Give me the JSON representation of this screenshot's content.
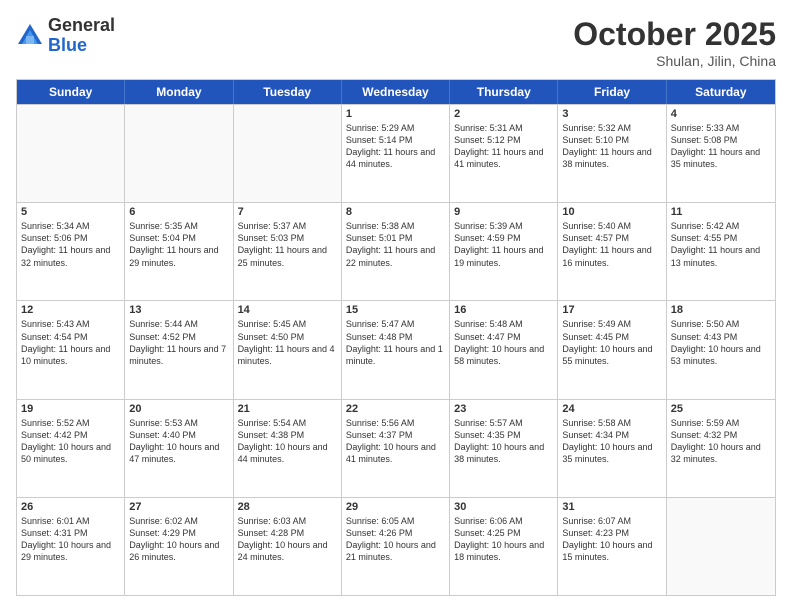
{
  "logo": {
    "general": "General",
    "blue": "Blue"
  },
  "title": "October 2025",
  "subtitle": "Shulan, Jilin, China",
  "days": [
    "Sunday",
    "Monday",
    "Tuesday",
    "Wednesday",
    "Thursday",
    "Friday",
    "Saturday"
  ],
  "weeks": [
    [
      {
        "day": "",
        "text": ""
      },
      {
        "day": "",
        "text": ""
      },
      {
        "day": "",
        "text": ""
      },
      {
        "day": "1",
        "text": "Sunrise: 5:29 AM\nSunset: 5:14 PM\nDaylight: 11 hours and 44 minutes."
      },
      {
        "day": "2",
        "text": "Sunrise: 5:31 AM\nSunset: 5:12 PM\nDaylight: 11 hours and 41 minutes."
      },
      {
        "day": "3",
        "text": "Sunrise: 5:32 AM\nSunset: 5:10 PM\nDaylight: 11 hours and 38 minutes."
      },
      {
        "day": "4",
        "text": "Sunrise: 5:33 AM\nSunset: 5:08 PM\nDaylight: 11 hours and 35 minutes."
      }
    ],
    [
      {
        "day": "5",
        "text": "Sunrise: 5:34 AM\nSunset: 5:06 PM\nDaylight: 11 hours and 32 minutes."
      },
      {
        "day": "6",
        "text": "Sunrise: 5:35 AM\nSunset: 5:04 PM\nDaylight: 11 hours and 29 minutes."
      },
      {
        "day": "7",
        "text": "Sunrise: 5:37 AM\nSunset: 5:03 PM\nDaylight: 11 hours and 25 minutes."
      },
      {
        "day": "8",
        "text": "Sunrise: 5:38 AM\nSunset: 5:01 PM\nDaylight: 11 hours and 22 minutes."
      },
      {
        "day": "9",
        "text": "Sunrise: 5:39 AM\nSunset: 4:59 PM\nDaylight: 11 hours and 19 minutes."
      },
      {
        "day": "10",
        "text": "Sunrise: 5:40 AM\nSunset: 4:57 PM\nDaylight: 11 hours and 16 minutes."
      },
      {
        "day": "11",
        "text": "Sunrise: 5:42 AM\nSunset: 4:55 PM\nDaylight: 11 hours and 13 minutes."
      }
    ],
    [
      {
        "day": "12",
        "text": "Sunrise: 5:43 AM\nSunset: 4:54 PM\nDaylight: 11 hours and 10 minutes."
      },
      {
        "day": "13",
        "text": "Sunrise: 5:44 AM\nSunset: 4:52 PM\nDaylight: 11 hours and 7 minutes."
      },
      {
        "day": "14",
        "text": "Sunrise: 5:45 AM\nSunset: 4:50 PM\nDaylight: 11 hours and 4 minutes."
      },
      {
        "day": "15",
        "text": "Sunrise: 5:47 AM\nSunset: 4:48 PM\nDaylight: 11 hours and 1 minute."
      },
      {
        "day": "16",
        "text": "Sunrise: 5:48 AM\nSunset: 4:47 PM\nDaylight: 10 hours and 58 minutes."
      },
      {
        "day": "17",
        "text": "Sunrise: 5:49 AM\nSunset: 4:45 PM\nDaylight: 10 hours and 55 minutes."
      },
      {
        "day": "18",
        "text": "Sunrise: 5:50 AM\nSunset: 4:43 PM\nDaylight: 10 hours and 53 minutes."
      }
    ],
    [
      {
        "day": "19",
        "text": "Sunrise: 5:52 AM\nSunset: 4:42 PM\nDaylight: 10 hours and 50 minutes."
      },
      {
        "day": "20",
        "text": "Sunrise: 5:53 AM\nSunset: 4:40 PM\nDaylight: 10 hours and 47 minutes."
      },
      {
        "day": "21",
        "text": "Sunrise: 5:54 AM\nSunset: 4:38 PM\nDaylight: 10 hours and 44 minutes."
      },
      {
        "day": "22",
        "text": "Sunrise: 5:56 AM\nSunset: 4:37 PM\nDaylight: 10 hours and 41 minutes."
      },
      {
        "day": "23",
        "text": "Sunrise: 5:57 AM\nSunset: 4:35 PM\nDaylight: 10 hours and 38 minutes."
      },
      {
        "day": "24",
        "text": "Sunrise: 5:58 AM\nSunset: 4:34 PM\nDaylight: 10 hours and 35 minutes."
      },
      {
        "day": "25",
        "text": "Sunrise: 5:59 AM\nSunset: 4:32 PM\nDaylight: 10 hours and 32 minutes."
      }
    ],
    [
      {
        "day": "26",
        "text": "Sunrise: 6:01 AM\nSunset: 4:31 PM\nDaylight: 10 hours and 29 minutes."
      },
      {
        "day": "27",
        "text": "Sunrise: 6:02 AM\nSunset: 4:29 PM\nDaylight: 10 hours and 26 minutes."
      },
      {
        "day": "28",
        "text": "Sunrise: 6:03 AM\nSunset: 4:28 PM\nDaylight: 10 hours and 24 minutes."
      },
      {
        "day": "29",
        "text": "Sunrise: 6:05 AM\nSunset: 4:26 PM\nDaylight: 10 hours and 21 minutes."
      },
      {
        "day": "30",
        "text": "Sunrise: 6:06 AM\nSunset: 4:25 PM\nDaylight: 10 hours and 18 minutes."
      },
      {
        "day": "31",
        "text": "Sunrise: 6:07 AM\nSunset: 4:23 PM\nDaylight: 10 hours and 15 minutes."
      },
      {
        "day": "",
        "text": ""
      }
    ]
  ]
}
